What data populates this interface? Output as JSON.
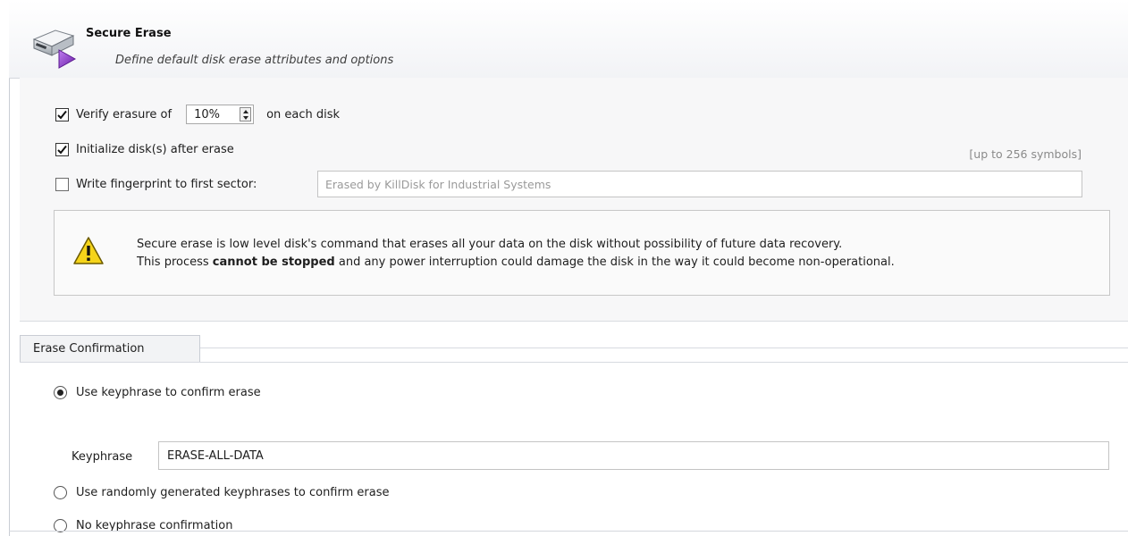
{
  "header": {
    "title": "Secure Erase",
    "subtitle": "Define default disk erase attributes and options",
    "icon": "disk-eraser-icon"
  },
  "options": {
    "verify": {
      "checked": true,
      "label_before": "Verify erasure of",
      "value": "10%",
      "label_after": "on each disk"
    },
    "initialize": {
      "checked": true,
      "label": "Initialize disk(s) after erase"
    },
    "fingerprint": {
      "checked": false,
      "label": "Write fingerprint to first sector:",
      "placeholder": "Erased by KillDisk for Industrial Systems",
      "hint": "[up to 256 symbols]"
    },
    "warning": {
      "line1": "Secure erase is low level disk's command that erases all your data on the disk without possibility of future data recovery.",
      "line2_before": "This process ",
      "line2_bold": "cannot be stopped",
      "line2_after": " and any power interruption could damage the disk in the way it could become non-operational."
    }
  },
  "confirmation": {
    "title": "Erase Confirmation",
    "options": [
      {
        "label": "Use keyphrase to confirm erase",
        "selected": true
      },
      {
        "label": "Use randomly generated keyphrases to confirm erase",
        "selected": false
      },
      {
        "label": "No keyphrase confirmation",
        "selected": false
      }
    ],
    "keyphrase_label": "Keyphrase",
    "keyphrase_value": "ERASE-ALL-DATA"
  },
  "colors": {
    "warning_yellow": "#f5d41a",
    "arrow_purple": "#8a35c9"
  }
}
